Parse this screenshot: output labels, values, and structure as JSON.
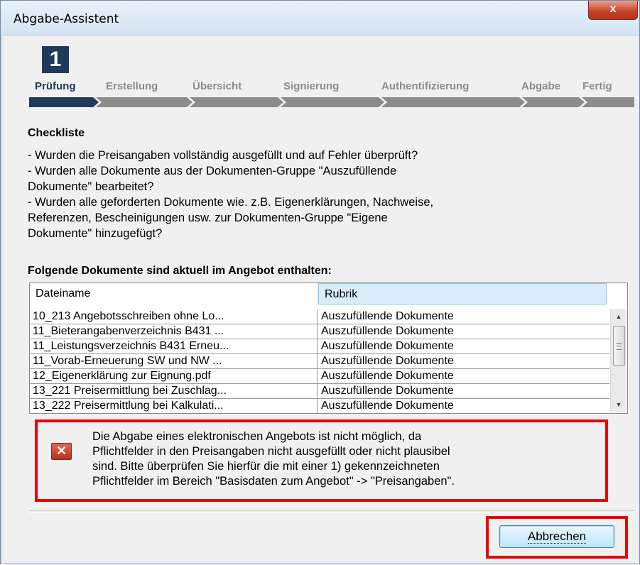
{
  "window": {
    "title": "Abgabe-Assistent",
    "close_label": "x"
  },
  "wizard": {
    "step_number": "1",
    "steps": [
      "Prüfung",
      "Erstellung",
      "Übersicht",
      "Signierung",
      "Authentifizierung",
      "Abgabe",
      "Fertig"
    ],
    "active_step": "Prüfung"
  },
  "checklist": {
    "title": "Checkliste",
    "lines": [
      "- Wurden die Preisangaben vollständig ausgefüllt und auf Fehler überprüft?",
      "- Wurden alle Dokumente aus der Dokumenten-Gruppe \"Auszufüllende",
      "Dokumente\" bearbeitet?",
      "- Wurden alle geforderten Dokumente wie. z.B. Eigenerklärungen, Nachweise,",
      "Referenzen, Bescheinigungen usw. zur Dokumenten-Gruppe \"Eigene",
      "Dokumente\" hinzugefügt?"
    ]
  },
  "documents": {
    "title": "Folgende Dokumente sind aktuell im Angebot enthalten:",
    "columns": [
      "Dateiname",
      "Rubrik"
    ],
    "rows": [
      [
        "10_213 Angebotsschreiben ohne Lo...",
        "Auszufüllende Dokumente"
      ],
      [
        "11_Bieterangabenverzeichnis B431 ...",
        "Auszufüllende Dokumente"
      ],
      [
        "11_Leistungsverzeichnis B431 Erneu...",
        "Auszufüllende Dokumente"
      ],
      [
        "11_Vorab-Erneuerung SW und NW ...",
        "Auszufüllende Dokumente"
      ],
      [
        "12_Eigenerklärung zur Eignung.pdf",
        "Auszufüllende Dokumente"
      ],
      [
        "13_221 Preisermittlung bei Zuschlag...",
        "Auszufüllende Dokumente"
      ],
      [
        "13_222 Preisermittlung bei Kalkulati...",
        "Auszufüllende Dokumente"
      ]
    ]
  },
  "error": {
    "lines": [
      "Die Abgabe eines elektronischen Angebots ist nicht möglich, da",
      "Pflichtfelder in den Preisangaben nicht ausgefüllt oder nicht plausibel",
      "sind. Bitte überprüfen Sie hierfür die mit einer 1) gekennzeichneten",
      "Pflichtfelder im Bereich \"Basisdaten zum Angebot\" -> \"Preisangaben\"."
    ],
    "icon_glyph": "✕"
  },
  "footer": {
    "cancel_label": "Abbrechen"
  },
  "colors": {
    "accent": "#1f3a5a",
    "inactive": "#8c8c8c",
    "error_outline": "#ee0000",
    "header_highlight": "#d8ecf9"
  }
}
